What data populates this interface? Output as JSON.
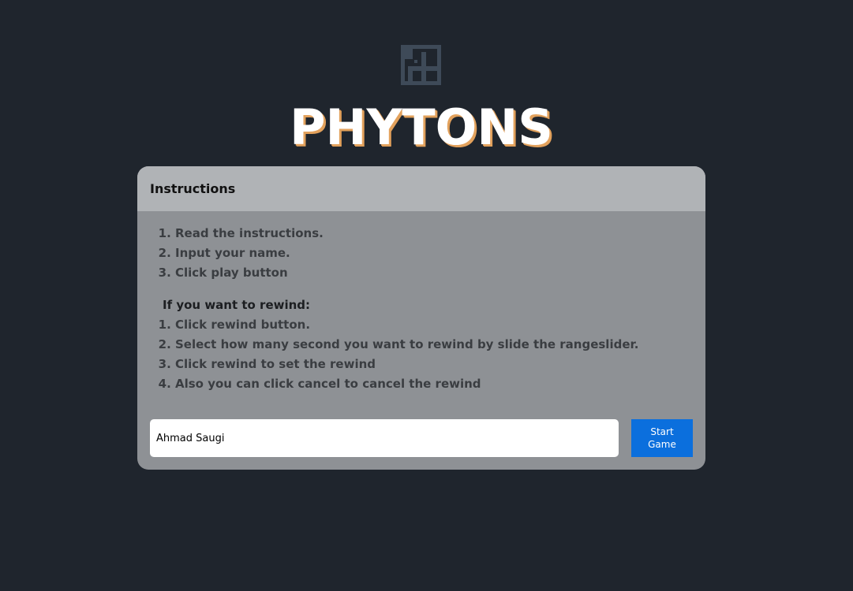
{
  "app": {
    "title": "PHYTONS",
    "logo_icon": "snake-grid-logo-icon"
  },
  "colors": {
    "background": "#1f252d",
    "title_shadow": "#e2a15c",
    "card_body": "#8e9195",
    "card_header": "#b0b3b6",
    "primary_button": "#0b6fdd"
  },
  "instructions": {
    "header": "Instructions",
    "steps": [
      "Read the instructions.",
      "Input your name.",
      "Click play button"
    ],
    "rewind_heading": "If you want to rewind:",
    "rewind_steps": [
      "Click rewind button.",
      "Select how many second you want to rewind by slide the rangeslider.",
      "Click rewind to set the rewind",
      "Also you can click cancel to cancel the rewind"
    ]
  },
  "form": {
    "name_value": "Ahmad Saugi",
    "start_label": "Start Game"
  }
}
